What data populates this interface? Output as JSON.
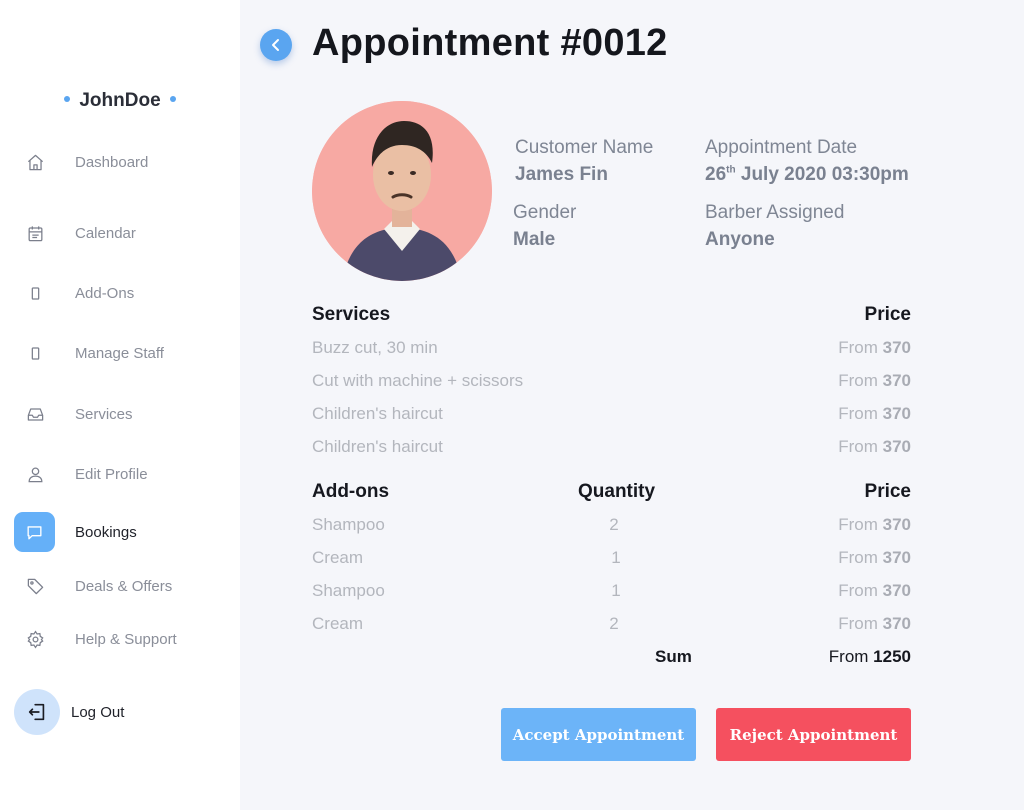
{
  "sidebar": {
    "username": "JohnDoe",
    "items": [
      {
        "label": "Dashboard",
        "icon": "home-icon"
      },
      {
        "label": "Calendar",
        "icon": "calendar-icon"
      },
      {
        "label": "Add-Ons",
        "icon": "phone-icon"
      },
      {
        "label": "Manage Staff",
        "icon": "phone-icon"
      },
      {
        "label": "Services",
        "icon": "inbox-icon"
      },
      {
        "label": "Edit Profile",
        "icon": "user-icon"
      },
      {
        "label": "Bookings",
        "icon": "message-icon",
        "active": true
      },
      {
        "label": "Deals & Offers",
        "icon": "tag-icon"
      },
      {
        "label": "Help & Support",
        "icon": "gear-icon"
      }
    ],
    "logout_label": "Log Out"
  },
  "header": {
    "title": "Appointment #0012"
  },
  "customer": {
    "name_label": "Customer Name",
    "name": "James Fin",
    "date_label": "Appointment Date",
    "date_day": "26",
    "date_suffix": "th",
    "date_rest": " July 2020 03:30pm",
    "gender_label": "Gender",
    "gender": "Male",
    "barber_label": "Barber Assigned",
    "barber": "Anyone"
  },
  "services": {
    "header": "Services",
    "price_header": "Price",
    "price_prefix": "From ",
    "rows": [
      {
        "name": "Buzz cut, 30 min",
        "price": "370"
      },
      {
        "name": "Cut with machine + scissors",
        "price": "370"
      },
      {
        "name": "Children's haircut",
        "price": "370"
      },
      {
        "name": "Children's haircut",
        "price": "370"
      }
    ]
  },
  "addons": {
    "header": "Add-ons",
    "quantity_header": "Quantity",
    "price_header": "Price",
    "price_prefix": "From ",
    "rows": [
      {
        "name": "Shampoo",
        "qty": "2",
        "price": "370"
      },
      {
        "name": "Cream",
        "qty": "1",
        "price": "370"
      },
      {
        "name": "Shampoo",
        "qty": "1",
        "price": "370"
      },
      {
        "name": "Cream",
        "qty": "2",
        "price": "370"
      }
    ],
    "sum_label": "Sum",
    "sum_prefix": "From ",
    "sum_value": "1250"
  },
  "actions": {
    "accept": "Accept Appointment",
    "reject": "Reject Appointment"
  },
  "colors": {
    "accent": "#65b0f8",
    "reject": "#f5505f",
    "avatar_bg": "#f7a9a3"
  }
}
